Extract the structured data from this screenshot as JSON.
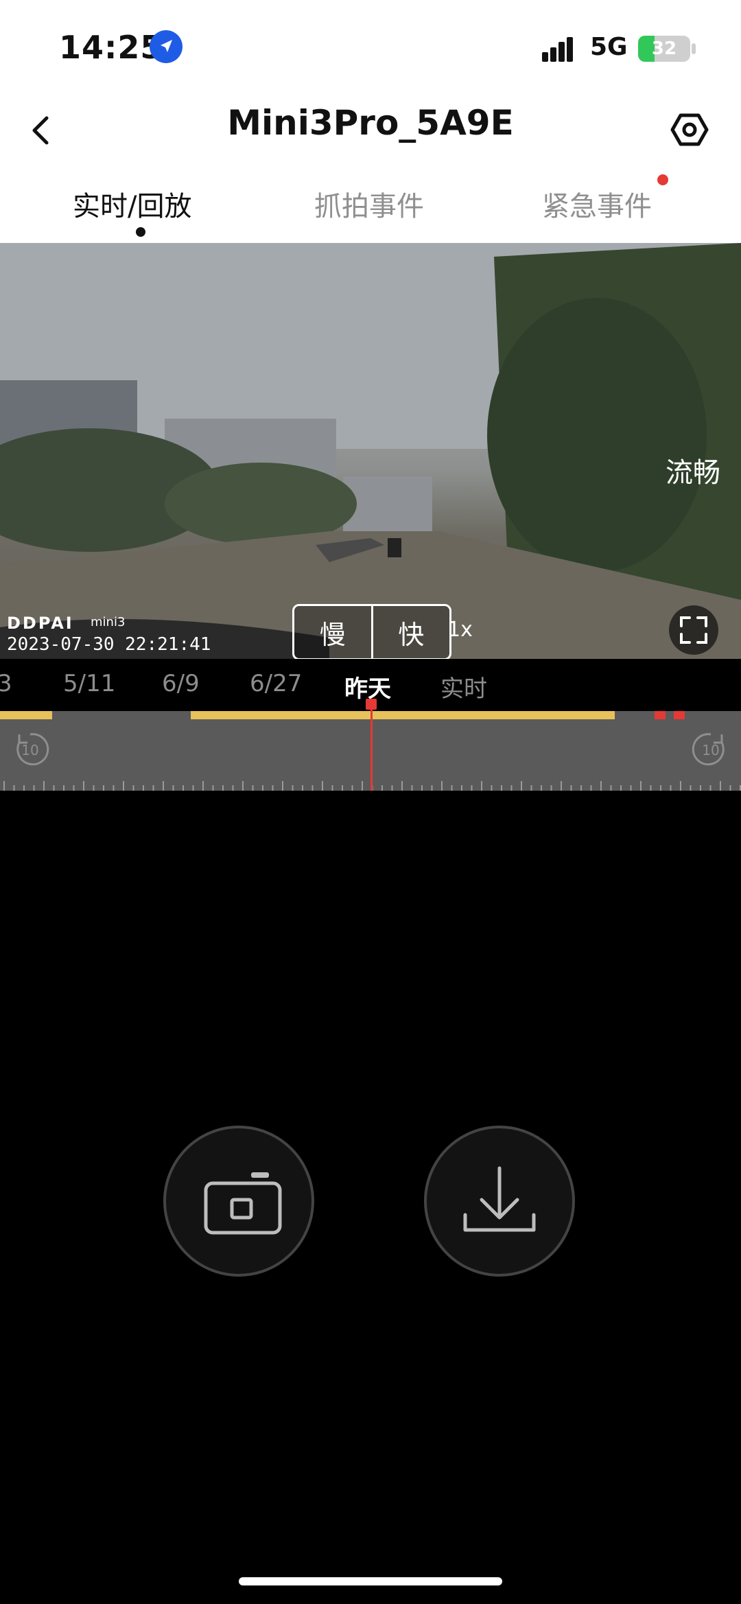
{
  "status_bar": {
    "time": "14:25",
    "network": "5G",
    "battery": "32"
  },
  "header": {
    "title": "Mini3Pro_5A9E"
  },
  "tabs": [
    {
      "label": "实时/回放",
      "active": true
    },
    {
      "label": "抓拍事件",
      "active": false
    },
    {
      "label": "紧急事件",
      "active": false,
      "has_notification": true
    }
  ],
  "video": {
    "quality": "流畅",
    "logo": "DDPAI",
    "logo_sub": "mini3",
    "timestamp": "2023-07-30 22:21:41",
    "speed_slow": "慢",
    "speed_fast": "快",
    "speed_rate": "1x"
  },
  "dates": [
    {
      "label": "3",
      "active": false
    },
    {
      "label": "5/11",
      "active": false
    },
    {
      "label": "6/9",
      "active": false
    },
    {
      "label": "6/27",
      "active": false
    },
    {
      "label": "昨天",
      "active": true
    },
    {
      "label": "实时",
      "active": false
    }
  ],
  "timeline": {
    "rewind_label": "10",
    "forward_label": "10"
  },
  "colors": {
    "accent": "#e53935",
    "recording": "#e8c15b",
    "battery": "#32c759"
  },
  "icons": [
    "location-arrow-icon",
    "signal-icon",
    "battery-icon",
    "back-icon",
    "settings-icon",
    "fullscreen-icon",
    "rewind-10-icon",
    "forward-10-icon",
    "camera-snapshot-icon",
    "download-icon"
  ]
}
